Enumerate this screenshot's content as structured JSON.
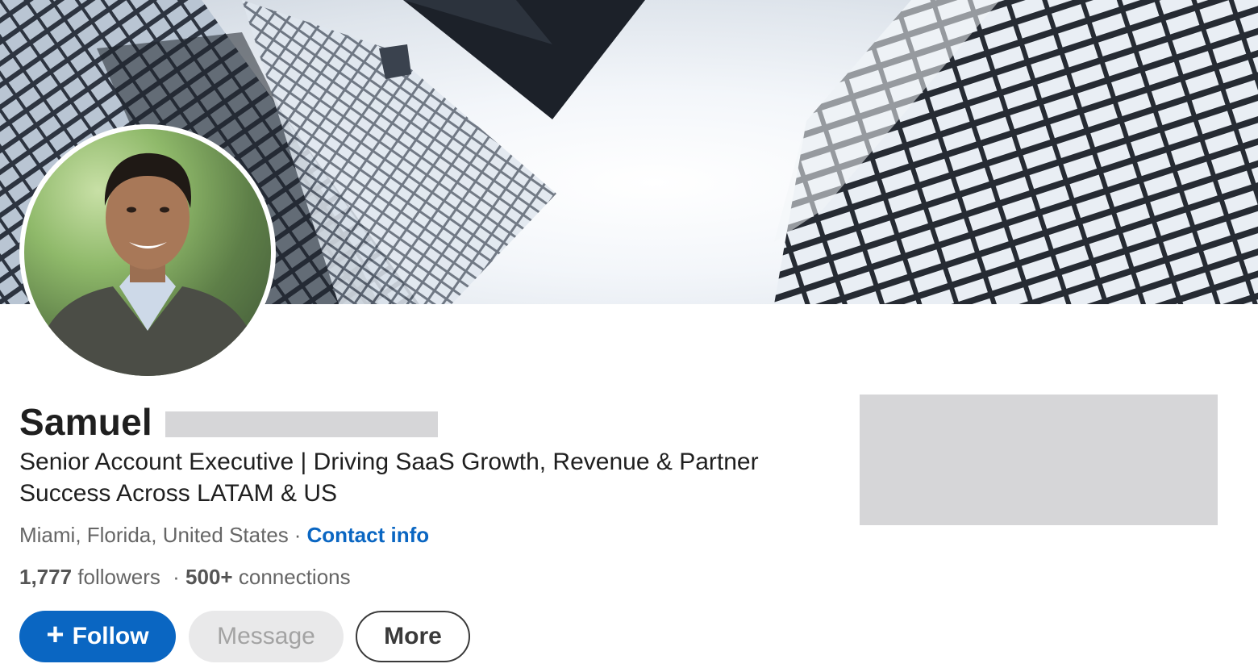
{
  "profile": {
    "name": "Samuel",
    "headline": "Senior Account Executive | Driving SaaS Growth, Revenue & Partner Success Across LATAM & US",
    "location": "Miami, Florida, United States",
    "separator": "·",
    "contact_info_label": "Contact info",
    "followers_count": "1,777",
    "followers_label": "followers",
    "connections_count": "500+",
    "connections_label": "connections"
  },
  "actions": {
    "follow_icon": "+",
    "follow_label": "Follow",
    "message_label": "Message",
    "more_label": "More"
  },
  "icons": {
    "follow": "plus-icon"
  },
  "colors": {
    "accent": "#0a66c2",
    "text": "#1f1f1f",
    "secondary_text": "#666666",
    "redaction": "#d6d6d8"
  }
}
